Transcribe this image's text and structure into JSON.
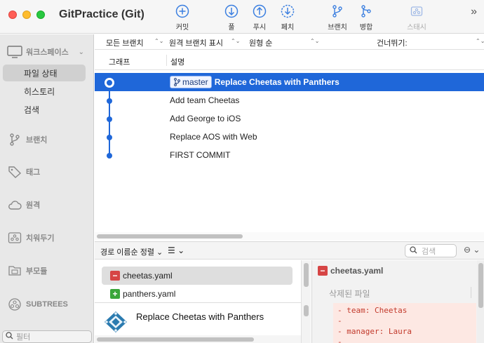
{
  "window": {
    "title": "GitPractice (Git)"
  },
  "toolbar": {
    "commit": "커밋",
    "pull": "풀",
    "push": "푸시",
    "fetch": "페치",
    "branch": "브랜치",
    "merge": "병합",
    "stash": "스태시",
    "more": "»",
    "accent": "#3b7fe0"
  },
  "sidebar": {
    "workspace": "워크스페이스",
    "items": [
      "파일 상태",
      "히스토리",
      "검색"
    ],
    "branches": "브랜치",
    "tags": "태그",
    "remotes": "원격",
    "stashes": "치워두기",
    "submodules": "부모듈",
    "subtrees": "SUBTREES",
    "filter_placeholder": "필터"
  },
  "filters": {
    "all_branches": "모든 브랜치",
    "show_remote": "원격 브랜치 표시",
    "order": "원형 순",
    "skip": "건너뛰기:"
  },
  "columns": {
    "graph": "그래프",
    "description": "설명"
  },
  "commits": [
    {
      "branch": "master",
      "message": "Replace Cheetas with Panthers",
      "selected": true
    },
    {
      "message": "Add team Cheetas"
    },
    {
      "message": "Add George to iOS"
    },
    {
      "message": "Replace AOS with Web"
    },
    {
      "message": "FIRST COMMIT"
    }
  ],
  "bottom": {
    "sort": "경로 이름순 정렬",
    "list_icon": "☰",
    "search_placeholder": "검색",
    "more_icon": "⊖"
  },
  "files": [
    {
      "name": "cheetas.yaml",
      "status": "deleted",
      "selected": true
    },
    {
      "name": "panthers.yaml",
      "status": "added"
    }
  ],
  "commit_detail": {
    "message": "Replace Cheetas with Panthers"
  },
  "diff": {
    "file": "cheetas.yaml",
    "status_text": "삭제된 파일",
    "lines": [
      "- team: Cheetas",
      "-",
      "- manager: Laura",
      "-"
    ]
  }
}
